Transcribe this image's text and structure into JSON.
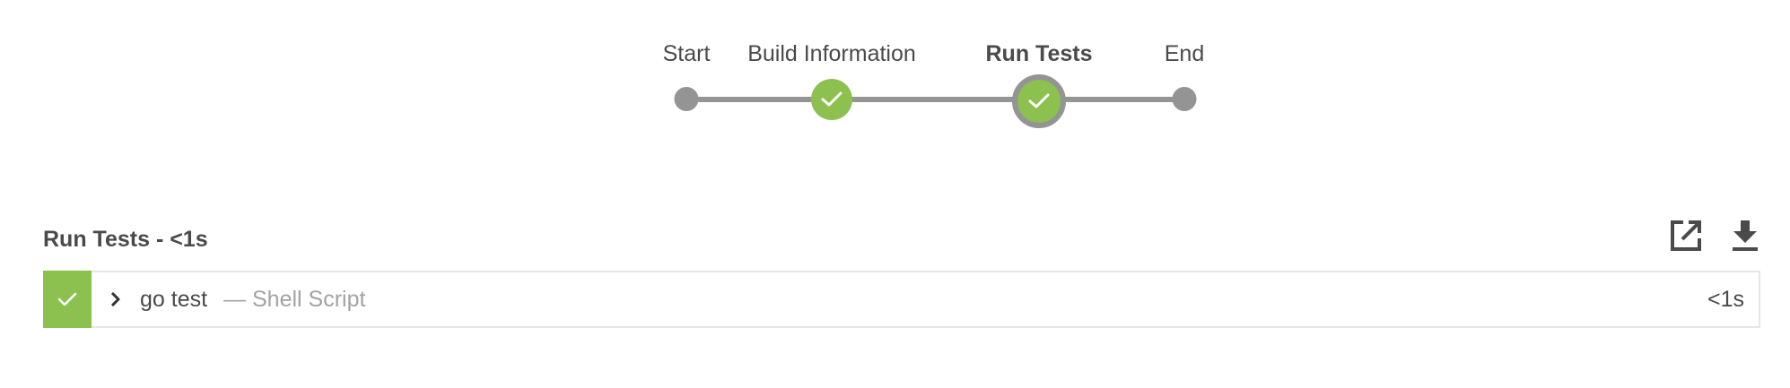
{
  "pipeline": {
    "stages": [
      {
        "label": "Start",
        "status": "start"
      },
      {
        "label": "Build Information",
        "status": "success"
      },
      {
        "label": "Run Tests",
        "status": "success",
        "selected": true
      },
      {
        "label": "End",
        "status": "end"
      }
    ]
  },
  "section": {
    "title": "Run Tests - <1s",
    "actions": [
      {
        "icon": "open-external-icon"
      },
      {
        "icon": "download-icon"
      }
    ]
  },
  "steps": [
    {
      "status": "success",
      "name": "go test",
      "type": "— Shell Script",
      "duration": "<1s"
    }
  ],
  "colors": {
    "success": "#8cc04f",
    "track": "#949494",
    "text": "#4a4a4a",
    "muted": "#a3a3a3",
    "border": "#e6e6e6"
  }
}
